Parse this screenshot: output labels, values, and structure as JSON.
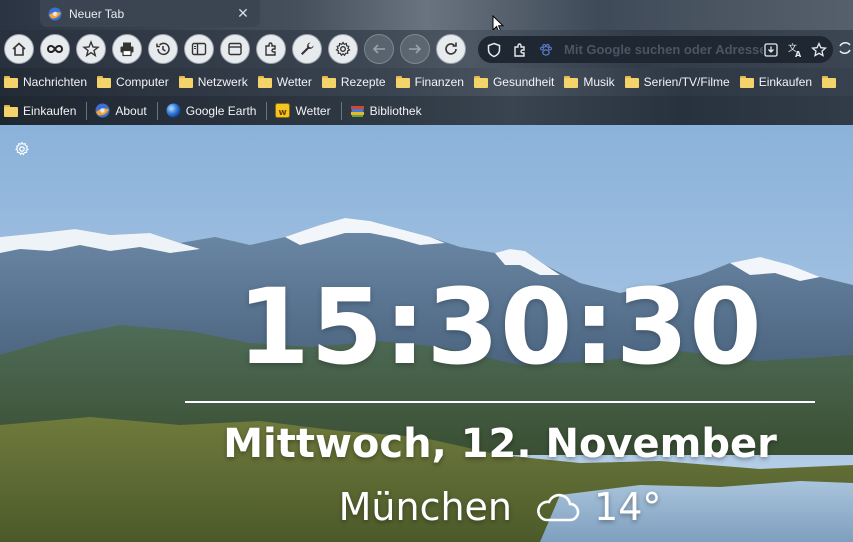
{
  "tab": {
    "title": "Neuer Tab",
    "close": "✕"
  },
  "urlbar": {
    "placeholder": "Mit Google suchen oder Adresse eingeben"
  },
  "bookmarks_row1": [
    "Nachrichten",
    "Computer",
    "Netzwerk",
    "Wetter",
    "Rezepte",
    "Finanzen",
    "Gesundheit",
    "Musik",
    "Serien/TV/Filme",
    "Einkaufen"
  ],
  "bookmarks_row2": {
    "einkaufen": "Einkaufen",
    "about": "About",
    "google_earth": "Google Earth",
    "wetter": "Wetter",
    "bibliothek": "Bibliothek"
  },
  "ntp": {
    "time": "15:30:30",
    "date": "Mittwoch, 12. November",
    "city": "München",
    "temperature": "14°",
    "weather_icon": "cloud-icon"
  },
  "colors": {
    "toolbar_button": "#e8ebee",
    "folder": "#f5d36b",
    "text_on_image": "#ffffff"
  }
}
